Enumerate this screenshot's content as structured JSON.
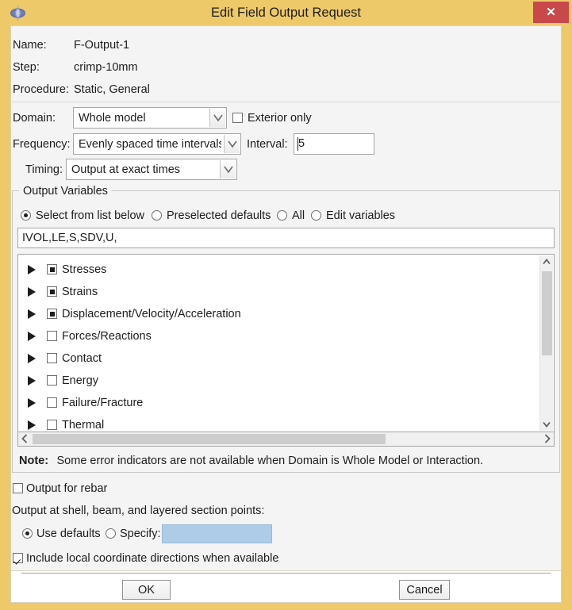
{
  "window": {
    "title": "Edit Field Output Request",
    "app_icon": "abaqus-diamond-icon",
    "close_label": "✕",
    "accent_color": "#eec96a",
    "close_color": "#c9484a"
  },
  "header": {
    "name_label": "Name:",
    "name_value": "F-Output-1",
    "step_label": "Step:",
    "step_value": "crimp-10mm",
    "procedure_label": "Procedure:",
    "procedure_value": "Static, General"
  },
  "settings": {
    "domain_label": "Domain:",
    "domain_value": "Whole model",
    "exterior_only_label": "Exterior only",
    "exterior_only_checked": false,
    "frequency_label": "Frequency:",
    "frequency_value": "Evenly spaced time intervals",
    "interval_label": "Interval:",
    "interval_value": "5",
    "timing_label": "Timing:",
    "timing_value": "Output at exact times"
  },
  "output_variables": {
    "group_title": "Output Variables",
    "modes": [
      {
        "label": "Select from list below",
        "selected": true
      },
      {
        "label": "Preselected defaults",
        "selected": false
      },
      {
        "label": "All",
        "selected": false
      },
      {
        "label": "Edit variables",
        "selected": false
      }
    ],
    "variables_text": "IVOL,LE,S,SDV,U,",
    "tree": [
      {
        "label": "Stresses",
        "state": "partial"
      },
      {
        "label": "Strains",
        "state": "partial"
      },
      {
        "label": "Displacement/Velocity/Acceleration",
        "state": "partial"
      },
      {
        "label": "Forces/Reactions",
        "state": "unchecked"
      },
      {
        "label": "Contact",
        "state": "unchecked"
      },
      {
        "label": "Energy",
        "state": "unchecked"
      },
      {
        "label": "Failure/Fracture",
        "state": "unchecked"
      },
      {
        "label": "Thermal",
        "state": "unchecked"
      }
    ],
    "note_prefix": "Note:",
    "note_body": "Some error indicators are not available when Domain is Whole Model or Interaction."
  },
  "bottom": {
    "rebar_label": "Output for rebar",
    "rebar_checked": false,
    "section_points_label": "Output at shell, beam, and layered section points:",
    "use_defaults_label": "Use defaults",
    "use_defaults_selected": true,
    "specify_label": "Specify:",
    "specify_selected": false,
    "specify_value": "",
    "local_dirs_label": "Include local coordinate directions when available",
    "local_dirs_checked": true
  },
  "footer": {
    "ok_label": "OK",
    "cancel_label": "Cancel"
  }
}
